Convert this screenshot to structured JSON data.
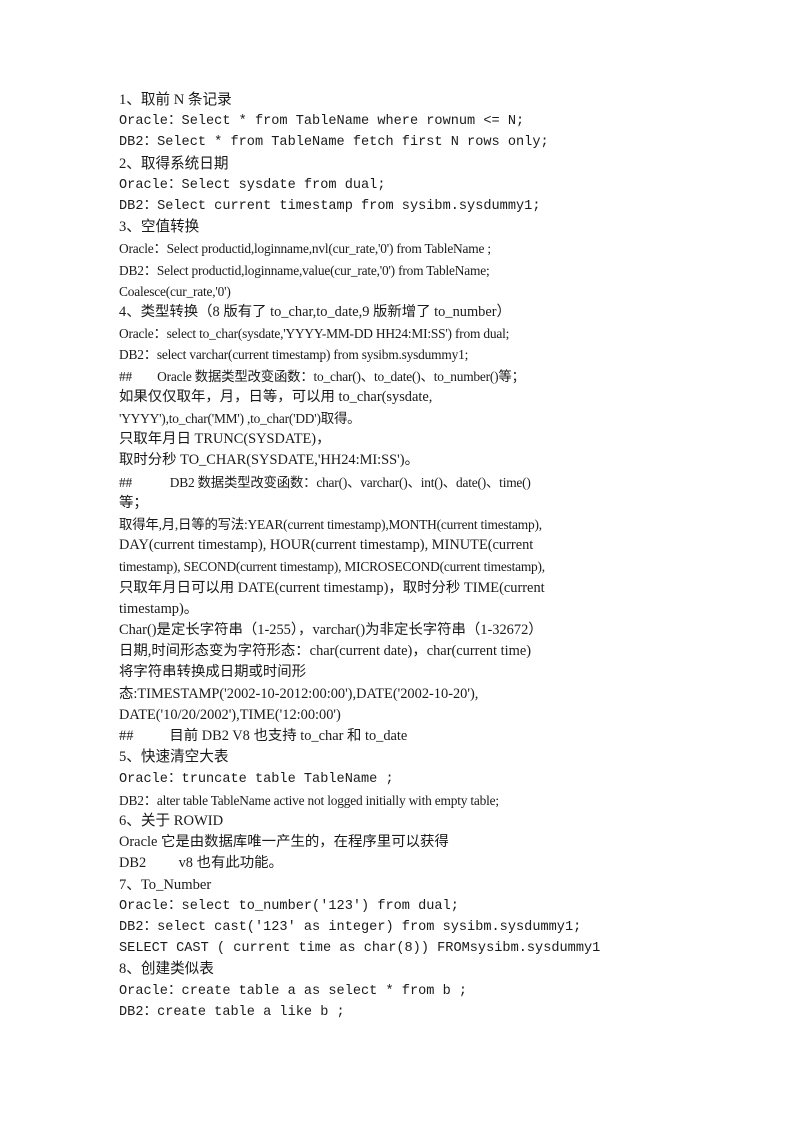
{
  "document": {
    "page_background": "#ffffff",
    "text_color": "#1a1a1a",
    "lines": [
      {
        "text": "1、取前 N 条记录",
        "style": "cjk"
      },
      {
        "text": "Oracle：Select * from TableName where rownum <= N;",
        "style": "mono"
      },
      {
        "text": "DB2：Select * from TableName fetch first N rows only;",
        "style": "mono"
      },
      {
        "text": "2、取得系统日期",
        "style": "cjk"
      },
      {
        "text": "Oracle：Select sysdate from dual;",
        "style": "mono"
      },
      {
        "text": "DB2：Select current timestamp from sysibm.sysdummy1;",
        "style": "mono"
      },
      {
        "text": "3、空值转换",
        "style": "cjk"
      },
      {
        "text": "Oracle：Select productid,loginname,nvl(cur_rate,'0') from TableName ;",
        "style": "tight"
      },
      {
        "text": "DB2：Select productid,loginname,value(cur_rate,'0') from TableName;",
        "style": "tight"
      },
      {
        "text": "Coalesce(cur_rate,'0')",
        "style": "tight"
      },
      {
        "text": "4、类型转换（8 版有了 to_char,to_date,9 版新增了 to_number）",
        "style": "mixed"
      },
      {
        "text": "Oracle：select to_char(sysdate,'YYYY-MM-DD HH24:MI:SS') from dual;",
        "style": "tight"
      },
      {
        "text": "DB2：select varchar(current timestamp) from sysibm.sysdummy1;",
        "style": "tight"
      },
      {
        "text": "##        Oracle 数据类型改变函数：to_char()、to_date()、to_number()等；",
        "style": "tight"
      },
      {
        "text": "如果仅仅取年，月，日等，可以用 to_char(sysdate,",
        "style": "mixed"
      },
      {
        "text": "'YYYY'),to_char('MM') ,to_char('DD')取得。",
        "style": "tight"
      },
      {
        "text": "只取年月日 TRUNC(SYSDATE)，",
        "style": "mixed"
      },
      {
        "text": "取时分秒 TO_CHAR(SYSDATE,'HH24:MI:SS')。",
        "style": "mixed"
      },
      {
        "text": "##            DB2 数据类型改变函数：char()、varchar()、int()、date()、time()",
        "style": "tight"
      },
      {
        "text": "等；",
        "style": "mixed"
      },
      {
        "text": "取得年,月,日等的写法:YEAR(current timestamp),MONTH(current timestamp),",
        "style": "tight"
      },
      {
        "text": "DAY(current timestamp), HOUR(current timestamp), MINUTE(current",
        "style": "mixed"
      },
      {
        "text": "timestamp), SECOND(current timestamp), MICROSECOND(current timestamp),",
        "style": "tight"
      },
      {
        "text": "只取年月日可以用 DATE(current timestamp)，取时分秒 TIME(current",
        "style": "mixed"
      },
      {
        "text": "timestamp)。",
        "style": "mixed"
      },
      {
        "text": "Char()是定长字符串（1-255），varchar()为非定长字符串（1-32672）",
        "style": "mixed"
      },
      {
        "text": "日期,时间形态变为字符形态：char(current date)，char(current time)",
        "style": "mixed"
      },
      {
        "text": "将字符串转换成日期或时间形",
        "style": "mixed"
      },
      {
        "text": "态:TIMESTAMP('2002-10-2012:00:00'),DATE('2002-10-20'),",
        "style": "mixed"
      },
      {
        "text": "DATE('10/20/2002'),TIME('12:00:00')",
        "style": "mixed"
      },
      {
        "text": "##          目前 DB2 V8 也支持 to_char 和 to_date",
        "style": "mixed"
      },
      {
        "text": "5、快速清空大表",
        "style": "cjk"
      },
      {
        "text": "Oracle：truncate table TableName ;",
        "style": "mono"
      },
      {
        "text": "DB2：alter table TableName active not logged initially with empty table;",
        "style": "tight"
      },
      {
        "text": "6、关于 ROWID",
        "style": "cjk"
      },
      {
        "text": "Oracle 它是由数据库唯一产生的，在程序里可以获得",
        "style": "mixed"
      },
      {
        "text": "DB2         v8 也有此功能。",
        "style": "mixed"
      },
      {
        "text": "7、To_Number",
        "style": "cjk"
      },
      {
        "text": "Oracle：select to_number('123') from dual;",
        "style": "mono"
      },
      {
        "text": "DB2：select cast('123' as integer) from sysibm.sysdummy1;",
        "style": "mono"
      },
      {
        "text": "SELECT CAST ( current time as char(8)) FROMsysibm.sysdummy1",
        "style": "mono"
      },
      {
        "text": "8、创建类似表",
        "style": "cjk"
      },
      {
        "text": "Oracle：create table a as select * from b ;",
        "style": "mono"
      },
      {
        "text": "DB2：create table a like b ;",
        "style": "mono"
      }
    ]
  }
}
